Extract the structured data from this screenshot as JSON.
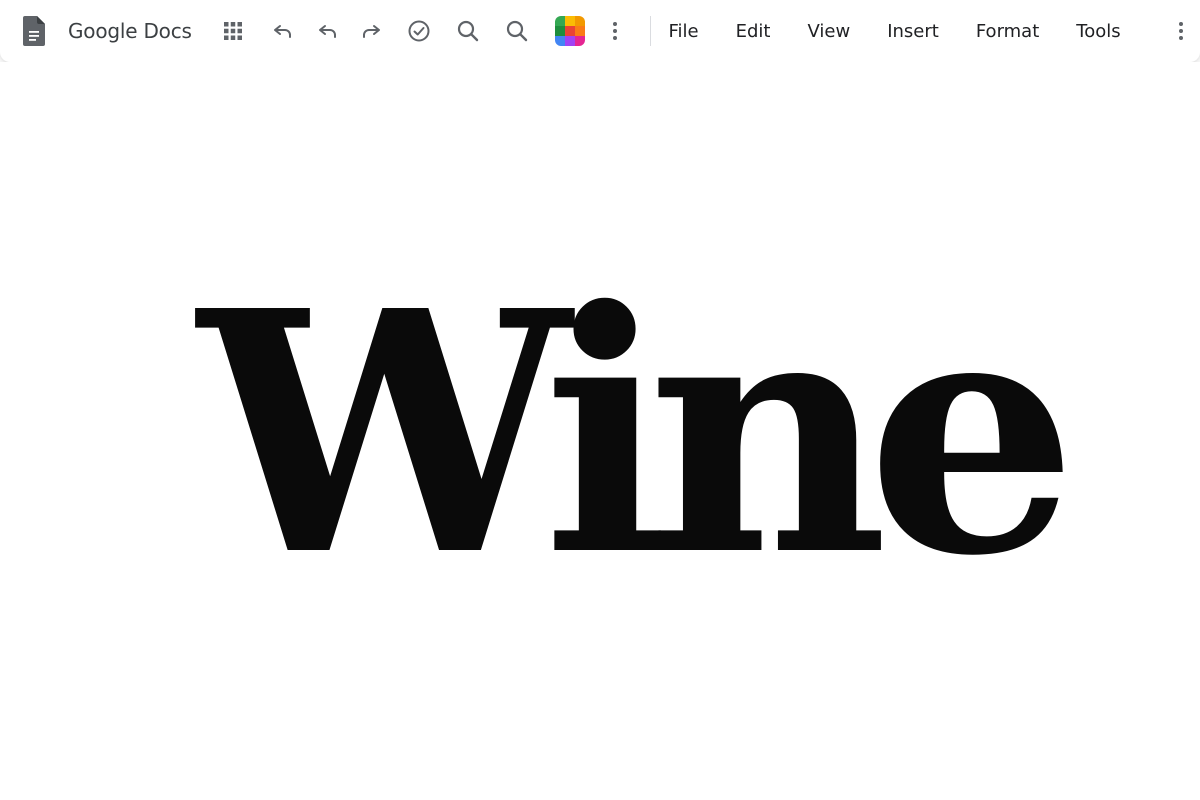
{
  "app": {
    "title": "Google Docs"
  },
  "toolbar": {
    "icons": [
      "docs-logo-icon",
      "apps-grid-icon",
      "undo-icon",
      "undo-icon",
      "redo-icon",
      "check-circle-icon",
      "search-icon",
      "search-icon",
      "color-palette-icon",
      "more-vertical-icon"
    ]
  },
  "menu": {
    "items": [
      "File",
      "Edit",
      "View",
      "Insert",
      "Format",
      "Tools"
    ],
    "overflow_icon": "more-vertical-icon"
  },
  "document": {
    "text": "Wine"
  },
  "colors": {
    "doc_blue": "#5f6368",
    "text": "#0a0a0a",
    "toolbar_icon": "#5f6368"
  }
}
